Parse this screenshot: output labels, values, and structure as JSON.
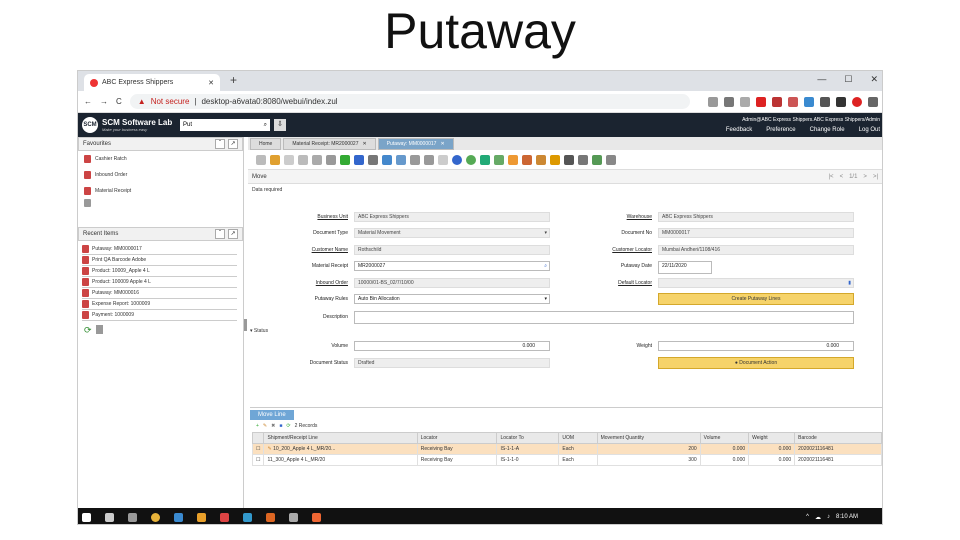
{
  "slide": {
    "title": "Putaway"
  },
  "browser": {
    "tab_title": "ABC Express Shippers",
    "new_tab": "+",
    "win_min": "—",
    "win_max": "☐",
    "win_close": "✕",
    "back": "←",
    "forward": "→",
    "reload": "C",
    "security": "Not secure",
    "url": "desktop-a6vata0:8080/webui/index.zul"
  },
  "app": {
    "logo_initials": "SCM",
    "logo_name": "SCM Software Lab",
    "tagline": "Make your business easy",
    "search_value": "Put",
    "user": "Admin@ABC Express Shippers.ABC Express Shippers/Admin",
    "links": [
      "Feedback",
      "Preference",
      "Change Role",
      "Log Out"
    ]
  },
  "sidebar": {
    "favourites_title": "Favourites",
    "favourites": [
      "Cashier Ratch",
      "Inbound Order",
      "Material Receipt"
    ],
    "recent_title": "Recent Items",
    "recent": [
      "Putaway: MM0000017",
      "Print QA Barcode Adobe",
      "Product: 10009_Apple 4 L",
      "Product: 100009 Apple 4 L",
      "Putaway: MM000016",
      "Expense Report: 1000009",
      "Payment: 1000009"
    ]
  },
  "window": {
    "tabs": [
      "Home",
      "Material Receipt: MR2000027",
      "Putaway: MM0000017"
    ],
    "title": "Move",
    "note": "Data required",
    "nav": [
      "|<",
      "<",
      "1/1",
      ">",
      ">|"
    ]
  },
  "form": {
    "business_unit_label": "Business Unit",
    "business_unit": "ABC Express Shippers",
    "document_type_label": "Document Type",
    "document_type": "Material Movement",
    "customer_name_label": "Customer Name",
    "customer_name": "Rothschild",
    "material_receipt_label": "Material Receipt",
    "material_receipt": "MR2000027",
    "inbound_order_label": "Inbound Order",
    "inbound_order": "10000/01-BS_02/7/10/00",
    "putaway_rules_label": "Putaway Rules",
    "putaway_rules": "Auto Bin Allocation",
    "description_label": "Description",
    "warehouse_label": "Warehouse",
    "warehouse": "ABC Express Shippers",
    "document_no_label": "Document No",
    "document_no": "MM0000017",
    "customer_locator_label": "Customer Locator",
    "customer_locator": "Mumbai Andheri/1108/416",
    "putaway_date_label": "Putaway Date",
    "putaway_date": "22/11/2020",
    "default_locator_label": "Default Locator",
    "create_putaway_label": "Create Putaway Lines",
    "status_section": "Status",
    "volume_label": "Volume",
    "volume": "0.000",
    "weight_label": "Weight",
    "weight": "0.000",
    "document_status_label": "Document Status",
    "document_status": "Drafted",
    "document_action_label": "Document Action"
  },
  "grid": {
    "tab": "Move Line",
    "records": "2 Records",
    "columns": [
      "",
      "Shipment/Receipt Line",
      "Locator",
      "Locator To",
      "UOM",
      "Movement Quantity",
      "Volume",
      "Weight",
      "Barcode"
    ],
    "rows": [
      [
        "",
        "10_200_Apple 4 L_MR/20...",
        "Receiving Bay",
        "IS-1-1-A",
        "Each",
        "200",
        "0.000",
        "0.000",
        "2020021116481"
      ],
      [
        "",
        "11_300_Apple 4 L_MR/20",
        "Receiving Bay",
        "IS-1-1-0",
        "Each",
        "300",
        "0.000",
        "0.000",
        "2020021116481"
      ]
    ]
  },
  "taskbar": {
    "time": "8:10 AM"
  },
  "colors": {
    "header": "#1b2430",
    "accent": "#6fa6d6",
    "button": "#f6d36a",
    "selected_row": "#fbe0bf"
  }
}
